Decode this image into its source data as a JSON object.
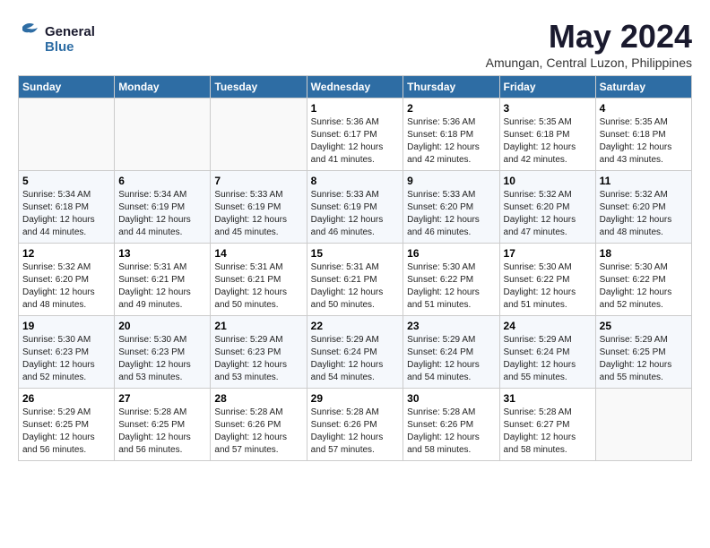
{
  "header": {
    "logo_line1": "General",
    "logo_line2": "Blue",
    "month_title": "May 2024",
    "subtitle": "Amungan, Central Luzon, Philippines"
  },
  "weekdays": [
    "Sunday",
    "Monday",
    "Tuesday",
    "Wednesday",
    "Thursday",
    "Friday",
    "Saturday"
  ],
  "weeks": [
    [
      {
        "day": "",
        "info": ""
      },
      {
        "day": "",
        "info": ""
      },
      {
        "day": "",
        "info": ""
      },
      {
        "day": "1",
        "info": "Sunrise: 5:36 AM\nSunset: 6:17 PM\nDaylight: 12 hours\nand 41 minutes."
      },
      {
        "day": "2",
        "info": "Sunrise: 5:36 AM\nSunset: 6:18 PM\nDaylight: 12 hours\nand 42 minutes."
      },
      {
        "day": "3",
        "info": "Sunrise: 5:35 AM\nSunset: 6:18 PM\nDaylight: 12 hours\nand 42 minutes."
      },
      {
        "day": "4",
        "info": "Sunrise: 5:35 AM\nSunset: 6:18 PM\nDaylight: 12 hours\nand 43 minutes."
      }
    ],
    [
      {
        "day": "5",
        "info": "Sunrise: 5:34 AM\nSunset: 6:18 PM\nDaylight: 12 hours\nand 44 minutes."
      },
      {
        "day": "6",
        "info": "Sunrise: 5:34 AM\nSunset: 6:19 PM\nDaylight: 12 hours\nand 44 minutes."
      },
      {
        "day": "7",
        "info": "Sunrise: 5:33 AM\nSunset: 6:19 PM\nDaylight: 12 hours\nand 45 minutes."
      },
      {
        "day": "8",
        "info": "Sunrise: 5:33 AM\nSunset: 6:19 PM\nDaylight: 12 hours\nand 46 minutes."
      },
      {
        "day": "9",
        "info": "Sunrise: 5:33 AM\nSunset: 6:20 PM\nDaylight: 12 hours\nand 46 minutes."
      },
      {
        "day": "10",
        "info": "Sunrise: 5:32 AM\nSunset: 6:20 PM\nDaylight: 12 hours\nand 47 minutes."
      },
      {
        "day": "11",
        "info": "Sunrise: 5:32 AM\nSunset: 6:20 PM\nDaylight: 12 hours\nand 48 minutes."
      }
    ],
    [
      {
        "day": "12",
        "info": "Sunrise: 5:32 AM\nSunset: 6:20 PM\nDaylight: 12 hours\nand 48 minutes."
      },
      {
        "day": "13",
        "info": "Sunrise: 5:31 AM\nSunset: 6:21 PM\nDaylight: 12 hours\nand 49 minutes."
      },
      {
        "day": "14",
        "info": "Sunrise: 5:31 AM\nSunset: 6:21 PM\nDaylight: 12 hours\nand 50 minutes."
      },
      {
        "day": "15",
        "info": "Sunrise: 5:31 AM\nSunset: 6:21 PM\nDaylight: 12 hours\nand 50 minutes."
      },
      {
        "day": "16",
        "info": "Sunrise: 5:30 AM\nSunset: 6:22 PM\nDaylight: 12 hours\nand 51 minutes."
      },
      {
        "day": "17",
        "info": "Sunrise: 5:30 AM\nSunset: 6:22 PM\nDaylight: 12 hours\nand 51 minutes."
      },
      {
        "day": "18",
        "info": "Sunrise: 5:30 AM\nSunset: 6:22 PM\nDaylight: 12 hours\nand 52 minutes."
      }
    ],
    [
      {
        "day": "19",
        "info": "Sunrise: 5:30 AM\nSunset: 6:23 PM\nDaylight: 12 hours\nand 52 minutes."
      },
      {
        "day": "20",
        "info": "Sunrise: 5:30 AM\nSunset: 6:23 PM\nDaylight: 12 hours\nand 53 minutes."
      },
      {
        "day": "21",
        "info": "Sunrise: 5:29 AM\nSunset: 6:23 PM\nDaylight: 12 hours\nand 53 minutes."
      },
      {
        "day": "22",
        "info": "Sunrise: 5:29 AM\nSunset: 6:24 PM\nDaylight: 12 hours\nand 54 minutes."
      },
      {
        "day": "23",
        "info": "Sunrise: 5:29 AM\nSunset: 6:24 PM\nDaylight: 12 hours\nand 54 minutes."
      },
      {
        "day": "24",
        "info": "Sunrise: 5:29 AM\nSunset: 6:24 PM\nDaylight: 12 hours\nand 55 minutes."
      },
      {
        "day": "25",
        "info": "Sunrise: 5:29 AM\nSunset: 6:25 PM\nDaylight: 12 hours\nand 55 minutes."
      }
    ],
    [
      {
        "day": "26",
        "info": "Sunrise: 5:29 AM\nSunset: 6:25 PM\nDaylight: 12 hours\nand 56 minutes."
      },
      {
        "day": "27",
        "info": "Sunrise: 5:28 AM\nSunset: 6:25 PM\nDaylight: 12 hours\nand 56 minutes."
      },
      {
        "day": "28",
        "info": "Sunrise: 5:28 AM\nSunset: 6:26 PM\nDaylight: 12 hours\nand 57 minutes."
      },
      {
        "day": "29",
        "info": "Sunrise: 5:28 AM\nSunset: 6:26 PM\nDaylight: 12 hours\nand 57 minutes."
      },
      {
        "day": "30",
        "info": "Sunrise: 5:28 AM\nSunset: 6:26 PM\nDaylight: 12 hours\nand 58 minutes."
      },
      {
        "day": "31",
        "info": "Sunrise: 5:28 AM\nSunset: 6:27 PM\nDaylight: 12 hours\nand 58 minutes."
      },
      {
        "day": "",
        "info": ""
      }
    ]
  ]
}
